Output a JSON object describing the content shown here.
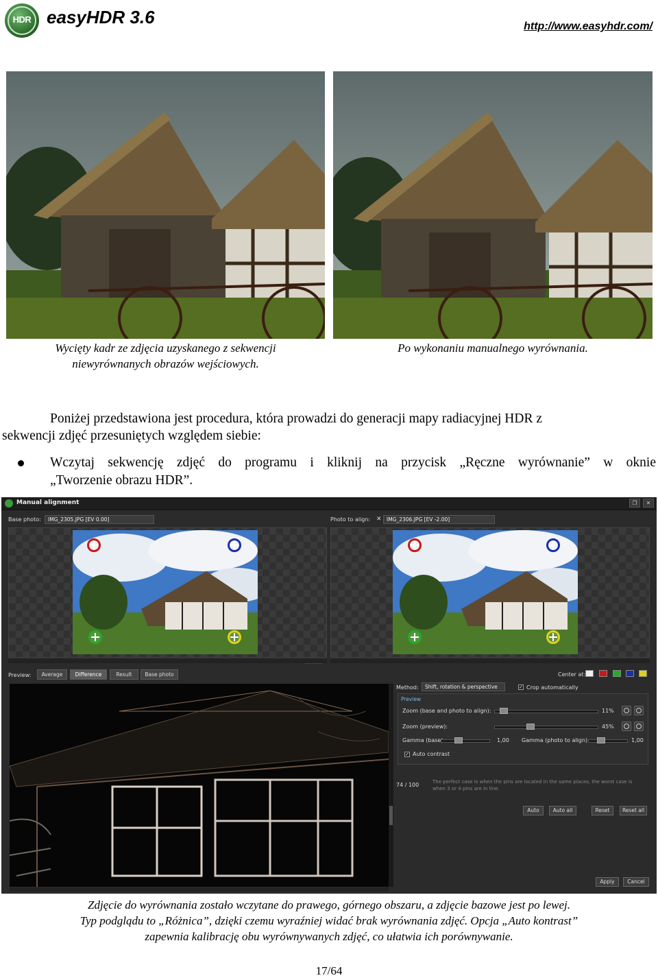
{
  "header": {
    "logo_text": "HDR",
    "title": "easyHDR 3.6",
    "url": "http://www.easyhdr.com/"
  },
  "photos": {
    "left_caption_line1": "Wycięty kadr ze zdjęcia uzyskanego z sekwencji",
    "left_caption_line2": "niewyrównanych obrazów wejściowych.",
    "right_caption": "Po wykonaniu manualnego wyrównania."
  },
  "body": {
    "para1_line1": "Poniżej przedstawiona jest procedura, która prowadzi do generacji mapy radiacyjnej HDR z",
    "para1_line2": "sekwencji zdjęć przesuniętych względem siebie:",
    "bullet_line1": "Wczytaj sekwencję zdjęć do programu i kliknij na przycisk „Ręczne wyrównanie” w oknie",
    "bullet_line2": "„Tworzenie obrazu HDR”."
  },
  "screenshot": {
    "window_title": "Manual alignment",
    "base_photo_label": "Base photo:",
    "base_photo_value": "IMG_2305.JPG [EV 0.00]",
    "photo_to_align_label": "Photo to align:",
    "photo_to_align_value": "IMG_2306.JPG [EV -2.00]",
    "preview_label": "Preview:",
    "preview_tabs": [
      "Average",
      "Difference",
      "Result",
      "Base photo"
    ],
    "active_tab": "Difference",
    "center_at_label": "Center at:",
    "pin_colors": [
      "#c81818",
      "#1a2fa8",
      "#1fae2a",
      "#e0d21a"
    ],
    "method_label": "Method:",
    "method_value": "Shift, rotation & perspective",
    "crop_auto": "Crop automatically",
    "preview_group": "Preview",
    "zoom_base_label": "Zoom (base and photo to align):",
    "zoom_base_value": "11%",
    "zoom_preview_label": "Zoom (preview):",
    "zoom_preview_value": "45%",
    "gamma_base_label": "Gamma (base):",
    "gamma_base_value": "1,00",
    "gamma_align_label": "Gamma (photo to align):",
    "gamma_align_value": "1,00",
    "auto_contrast": "Auto contrast",
    "score": "74 / 100",
    "hint": "The perfect case is when the pins are located in the same places, the worst case is when 3 or 4 pins are in line.",
    "btn_auto": "Auto",
    "btn_auto_all": "Auto all",
    "btn_reset": "Reset",
    "btn_reset_all": "Reset all",
    "btn_apply": "Apply",
    "btn_cancel": "Cancel"
  },
  "bottom_caption": {
    "line1": "Zdjęcie do wyrównania zostało wczytane do prawego, górnego obszaru, a zdjęcie bazowe jest po lewej.",
    "line2": "Typ podglądu to „Różnica”, dzięki czemu wyraźniej widać brak wyrównania zdjęć. Opcja „Auto kontrast”",
    "line3": "zapewnia kalibrację obu wyrównywanych zdjęć, co ułatwia ich porównywanie."
  },
  "page_number": "17/64"
}
